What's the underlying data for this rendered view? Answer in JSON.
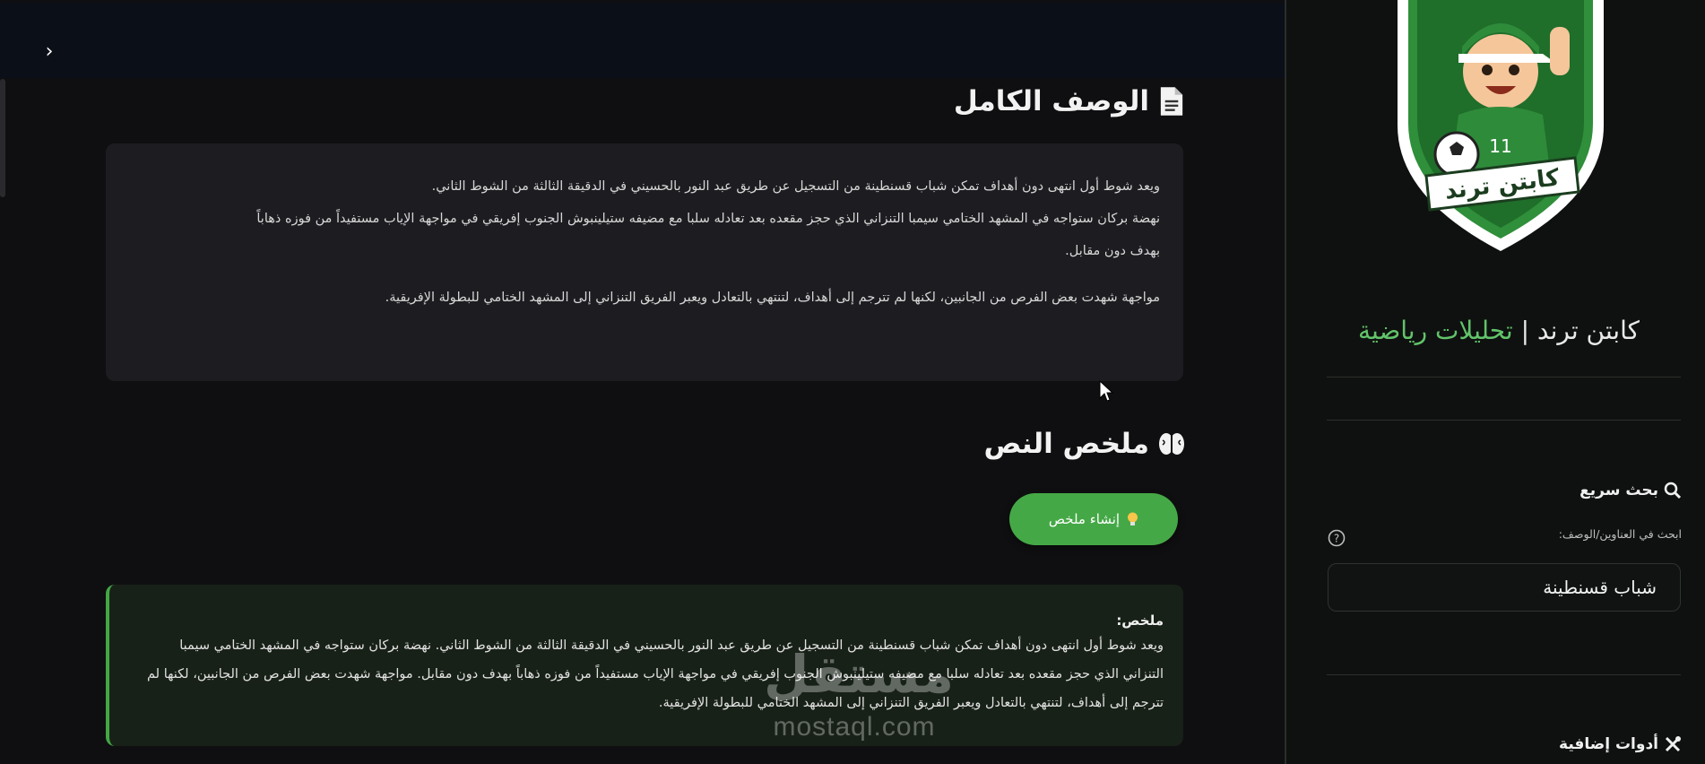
{
  "main": {
    "back_icon": "chevron-right-icon",
    "full_description": {
      "title": "الوصف الكامل",
      "icon": "document-icon",
      "paragraphs": [
        "ويعد شوط أول انتهى دون أهداف تمكن شباب قسنطينة من التسجيل عن طريق عبد النور بالحسيني في الدقيقة الثالثة من الشوط الثاني.",
        "نهضة بركان ستواجه في المشهد الختامي سيمبا التنزاني الذي حجز مقعده بعد تعادله سلبا مع مضيفه ستيلينبوش الجنوب إفريقي في مواجهة الإياب مستفيداً من فوزه ذهاباً",
        "بهدف دون مقابل.",
        "مواجهة شهدت بعض الفرص من الجانبين، لكنها لم تترجم إلى أهداف، لتنتهي بالتعادل ويعبر الفريق التنزاني إلى المشهد الختامي للبطولة الإفريقية."
      ]
    },
    "summary_section": {
      "title": "ملخص النص",
      "icon": "brain-icon",
      "generate_button": "إنشاء ملخص",
      "generate_icon": "lightbulb-icon",
      "summary_label": "ملخص:",
      "summary_text": "ويعد شوط أول انتهى دون أهداف تمكن شباب قسنطينة من التسجيل عن طريق عبد النور بالحسيني في الدقيقة الثالثة من الشوط الثاني. نهضة بركان ستواجه في المشهد الختامي سيمبا التنزاني الذي حجز مقعده بعد تعادله سلبا مع مضيفه ستيلينبوش الجنوب إفريقي في مواجهة الإياب مستفيداً من فوزه ذهاباً بهدف دون مقابل. مواجهة شهدت بعض الفرص من الجانبين، لكنها لم تترجم إلى أهداف، لتنتهي بالتعادل ويعبر الفريق التنزاني إلى المشهد الختامي للبطولة الإفريقية."
    },
    "watermark": {
      "arabic": "مستقل",
      "latin": "mostaql.com"
    }
  },
  "sidebar": {
    "logo_text": "كابتن ترند",
    "logo_jersey_number": "11",
    "brand_name": "كابتن ترند",
    "brand_separator": "|",
    "brand_tagline": "تحليلات رياضية",
    "quick_search": {
      "title": "بحث سريع",
      "icon": "search-icon",
      "field_label": "ابحث في العناوين/الوصف:",
      "help_icon": "question-circle-icon",
      "value": "شباب قسنطينة"
    },
    "extra_tools": {
      "title": "أدوات إضافية",
      "icon": "tools-icon"
    }
  },
  "colors": {
    "accent_green": "#45a846",
    "brand_green": "#62c36a",
    "panel": "#1d1d21",
    "summary_bg": "#182118"
  }
}
